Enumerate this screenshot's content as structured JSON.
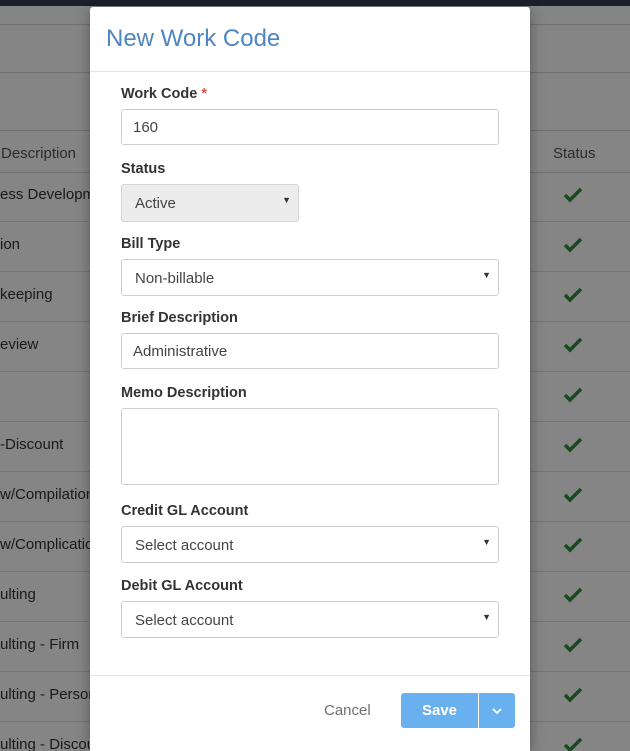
{
  "background": {
    "columns": {
      "description": "Description",
      "status": "Status"
    },
    "rows": [
      "ess Development",
      "ion",
      "keeping",
      "eview",
      "",
      "-Discount",
      "w/Compilation",
      "w/Complication",
      "ulting",
      "ulting - Firm",
      "ulting - Personal",
      "ulting - Discount"
    ],
    "check_color": "#2f8f3a"
  },
  "modal": {
    "title": "New Work Code",
    "work_code": {
      "label": "Work Code",
      "required_mark": "*",
      "value": "160"
    },
    "status": {
      "label": "Status",
      "value": "Active"
    },
    "bill_type": {
      "label": "Bill Type",
      "value": "Non-billable"
    },
    "brief_description": {
      "label": "Brief Description",
      "value": "Administrative"
    },
    "memo_description": {
      "label": "Memo Description",
      "value": ""
    },
    "credit_gl": {
      "label": "Credit GL Account",
      "value": "Select account"
    },
    "debit_gl": {
      "label": "Debit GL Account",
      "value": "Select account"
    },
    "footer": {
      "cancel_label": "Cancel",
      "save_label": "Save"
    }
  },
  "colors": {
    "title": "#4f86c1",
    "save_button": "#69b0ee",
    "required": "#d9534f"
  }
}
